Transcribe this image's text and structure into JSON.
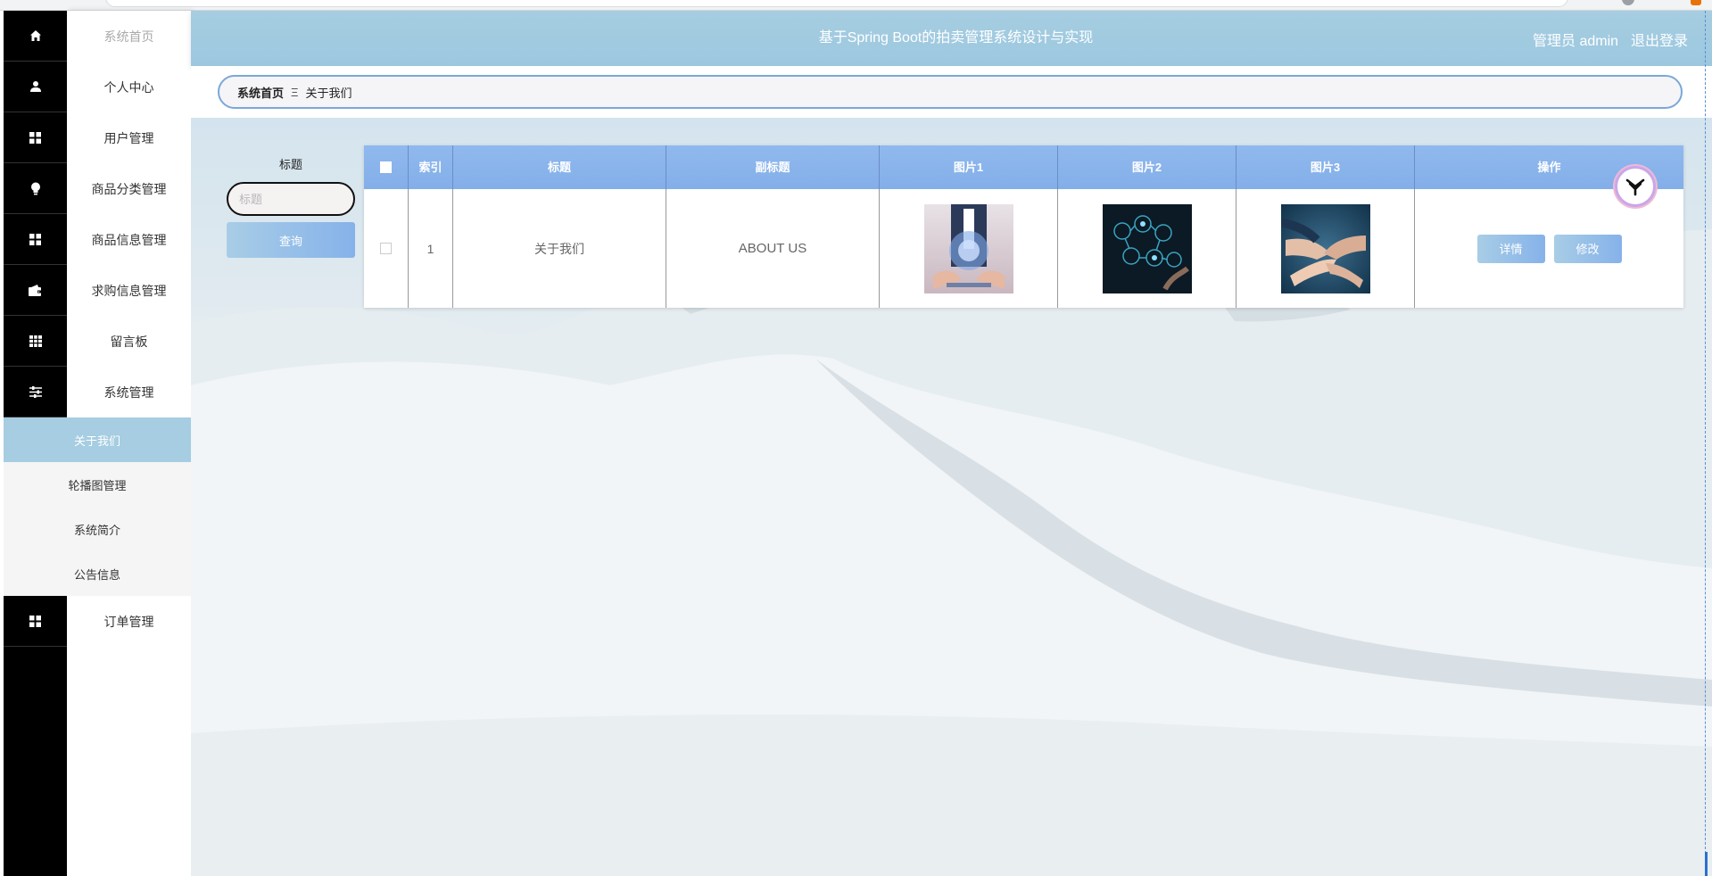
{
  "app": {
    "title": "基于Spring Boot的拍卖管理系统设计与实现",
    "user_label": "管理员 admin",
    "logout_label": "退出登录"
  },
  "sidebar": {
    "items": [
      {
        "label": "系统首页",
        "icon": "home-icon"
      },
      {
        "label": "个人中心",
        "icon": "user-icon"
      },
      {
        "label": "用户管理",
        "icon": "grid-icon"
      },
      {
        "label": "商品分类管理",
        "icon": "bulb-icon"
      },
      {
        "label": "商品信息管理",
        "icon": "grid-icon"
      },
      {
        "label": "求购信息管理",
        "icon": "wallet-icon"
      },
      {
        "label": "留言板",
        "icon": "table-icon"
      },
      {
        "label": "系统管理",
        "icon": "sliders-icon"
      }
    ],
    "submenu": [
      {
        "label": "关于我们",
        "active": true
      },
      {
        "label": "轮播图管理",
        "active": false
      },
      {
        "label": "系统简介",
        "active": false
      },
      {
        "label": "公告信息",
        "active": false
      }
    ],
    "after": {
      "label": "订单管理",
      "icon": "grid-icon"
    }
  },
  "breadcrumb": {
    "home": "系统首页",
    "separator": "Ξ",
    "current": "关于我们"
  },
  "search": {
    "label": "标题",
    "placeholder": "标题",
    "button": "查询"
  },
  "table": {
    "headers": [
      "索引",
      "标题",
      "副标题",
      "图片1",
      "图片2",
      "图片3",
      "操作"
    ],
    "rows": [
      {
        "index": "1",
        "title": "关于我们",
        "subtitle": "ABOUT US",
        "image1": "business-hologram-image",
        "image2": "tech-network-image",
        "image3": "team-hands-image",
        "detail_label": "详情",
        "edit_label": "修改"
      }
    ]
  },
  "colors": {
    "header": "#a6cde1",
    "table_header": "#89b3eb",
    "button": "#96bfe8",
    "sidebar_dark": "#000000"
  }
}
